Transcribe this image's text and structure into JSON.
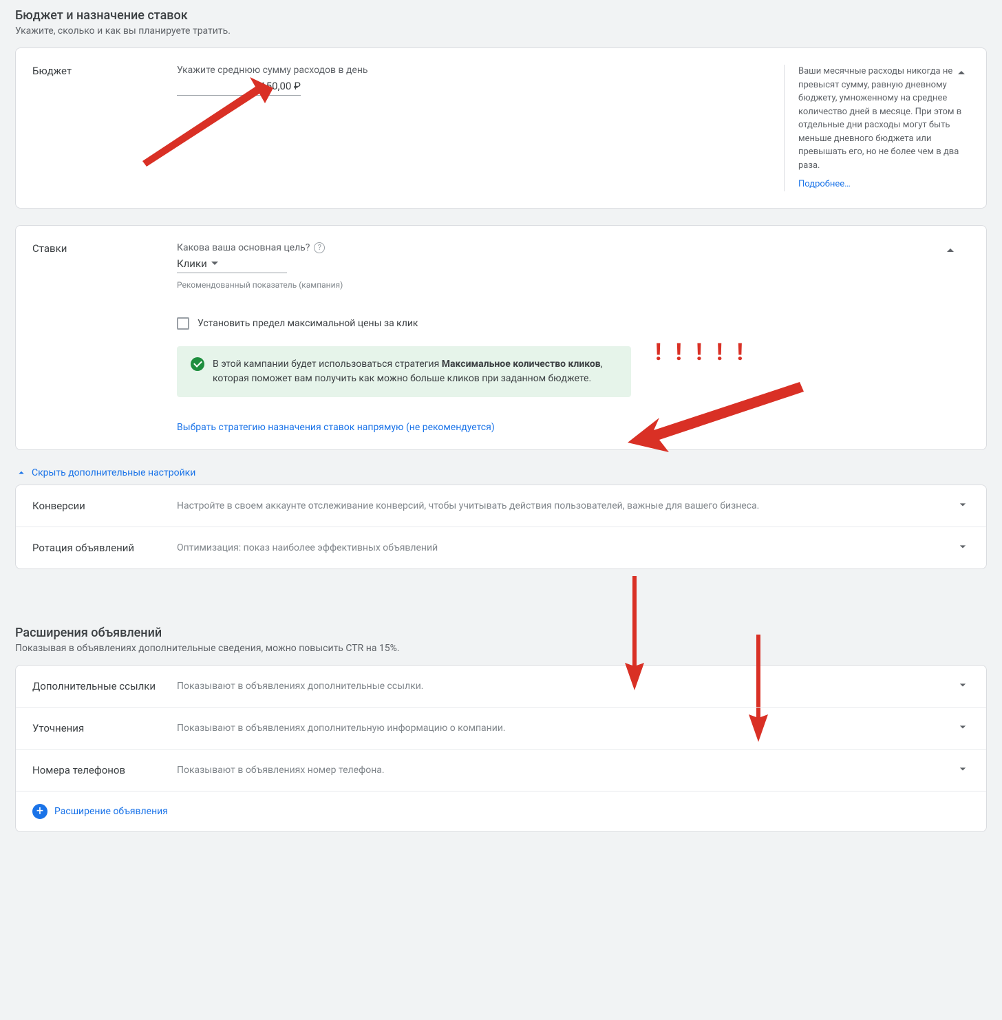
{
  "section_budget": {
    "title": "Бюджет и назначение ставок",
    "subtitle": "Укажите, сколько и как вы планируете тратить."
  },
  "budget": {
    "label": "Бюджет",
    "field_label": "Укажите среднюю сумму расходов в день",
    "value": "150,00 ₽",
    "info_text": "Ваши месячные расходы никогда не превысят сумму, равную дневному бюджету, умноженному на среднее количество дней в месяце. При этом в отдельные дни расходы могут быть меньше дневного бюджета или превышать его, но не более чем в два раза.",
    "more_link": "Подробнее…"
  },
  "bids": {
    "label": "Ставки",
    "goal_label": "Какова ваша основная цель?",
    "goal_selected": "Клики",
    "recommended": "Рекомендованный показатель (кампания)",
    "cpc_checkbox": "Установить предел максимальной цены за клик",
    "strategy_info_prefix": "В этой кампании будет использоваться стратегия ",
    "strategy_bold": "Максимальное количество кликов",
    "strategy_info_suffix": ", которая поможет вам получить как можно больше кликов при заданном бюджете.",
    "direct_link": "Выбрать стратегию назначения ставок напрямую (не рекомендуется)"
  },
  "extra_toggle": "Скрыть дополнительные настройки",
  "extra": {
    "conversions_label": "Конверсии",
    "conversions_desc": "Настройте в своем аккаунте отслеживание конверсий, чтобы учитывать действия пользователей, важные для вашего бизнеса.",
    "rotation_label": "Ротация объявлений",
    "rotation_desc": "Оптимизация: показ наиболее эффективных объявлений"
  },
  "extensions": {
    "title": "Расширения объявлений",
    "subtitle": "Показывая в объявлениях дополнительные сведения, можно повысить CTR на 15%.",
    "sitelinks_label": "Дополнительные ссылки",
    "sitelinks_desc": "Показывают в объявлениях дополнительные ссылки.",
    "callouts_label": "Уточнения",
    "callouts_desc": "Показывают в объявлениях дополнительную информацию о компании.",
    "phones_label": "Номера телефонов",
    "phones_desc": "Показывают в объявлениях номер телефона.",
    "add_label": "Расширение объявления"
  },
  "annotations": {
    "exclaim": "! ! ! ! !"
  }
}
